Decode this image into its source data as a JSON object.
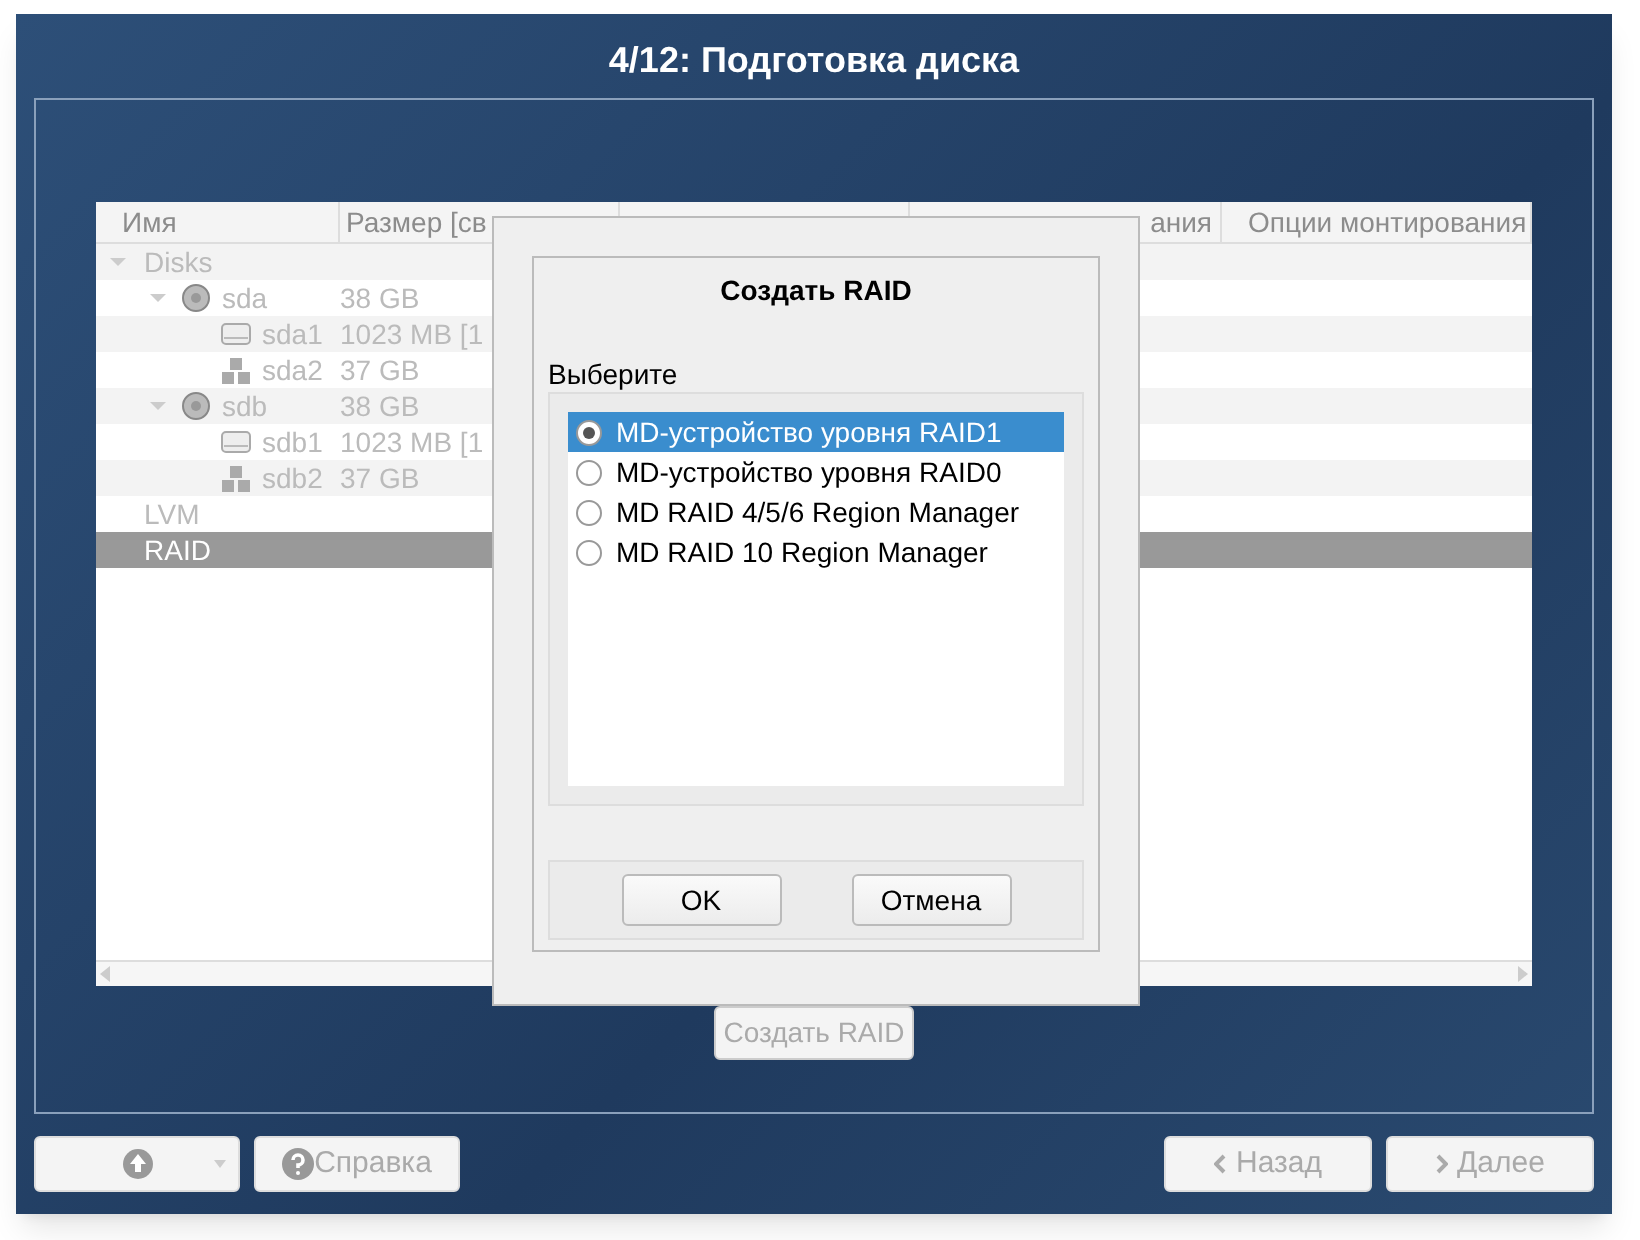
{
  "window": {
    "title": "4/12: Подготовка диска"
  },
  "table": {
    "columns": [
      "Имя",
      "Размер [св",
      "",
      "ания",
      "Опции монтирования"
    ],
    "rows": [
      {
        "name": "Disks",
        "size": "",
        "expanded": true,
        "selected": false,
        "children": [
          {
            "name": "sda",
            "size": "38 GB",
            "kind": "disk",
            "expanded": true,
            "selected": false,
            "children": [
              {
                "name": "sda1",
                "size": "1023 MB [1",
                "kind": "partition",
                "selected": false
              },
              {
                "name": "sda2",
                "size": "37 GB",
                "kind": "volume",
                "selected": false
              }
            ]
          },
          {
            "name": "sdb",
            "size": "38 GB",
            "kind": "disk",
            "expanded": true,
            "selected": false,
            "children": [
              {
                "name": "sdb1",
                "size": "1023 MB [1",
                "kind": "partition",
                "selected": false
              },
              {
                "name": "sdb2",
                "size": "37 GB",
                "kind": "volume",
                "selected": false
              }
            ]
          }
        ]
      },
      {
        "name": "LVM",
        "size": "",
        "selected": false
      },
      {
        "name": "RAID",
        "size": "",
        "selected": true
      }
    ]
  },
  "create_raid_button": {
    "label": "Создать RAID",
    "disabled": true
  },
  "dialog": {
    "title": "Создать RAID",
    "prompt": "Выберите",
    "options": [
      {
        "label": "MD-устройство уровня RAID1",
        "selected": true
      },
      {
        "label": "MD-устройство уровня RAID0",
        "selected": false
      },
      {
        "label": "MD RAID 4/5/6 Region Manager",
        "selected": false
      },
      {
        "label": "MD RAID 10 Region Manager",
        "selected": false
      }
    ],
    "buttons": [
      "OK",
      "Отмена"
    ]
  },
  "footer": {
    "help": "Справка",
    "back": "Назад",
    "next": "Далее"
  }
}
